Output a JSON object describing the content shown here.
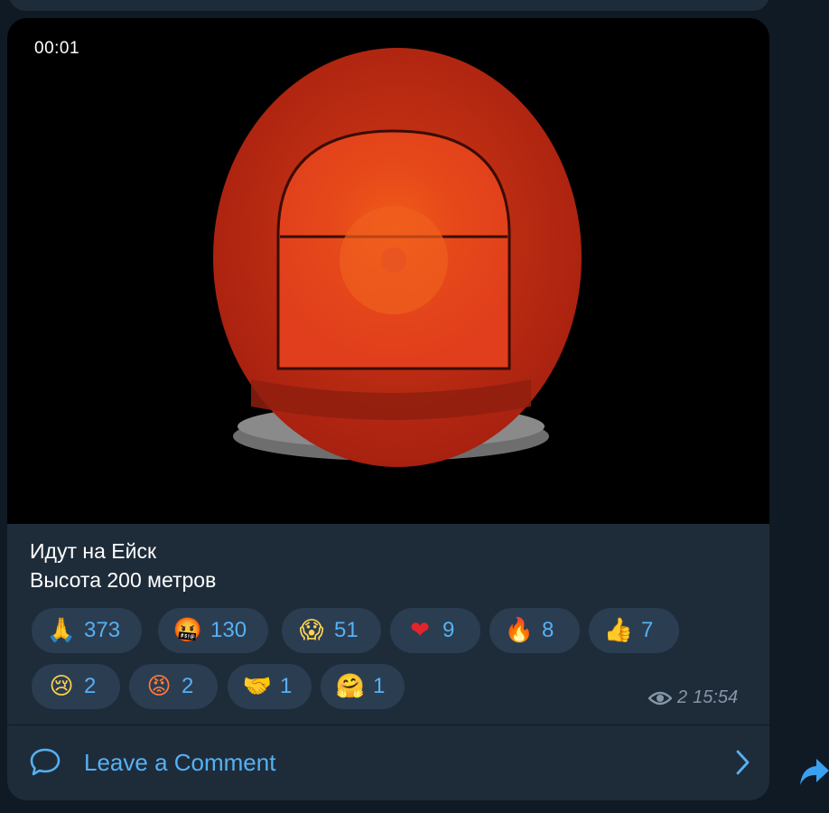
{
  "media": {
    "duration": "00:01"
  },
  "caption": {
    "line1": "Идут на Ейск",
    "line2": "Высота 200 метров"
  },
  "reactions": [
    {
      "icon": "praying-hands-emoji",
      "glyph": "🙏",
      "count": "373"
    },
    {
      "icon": "cursing-face-emoji",
      "glyph": "🤬",
      "count": "130"
    },
    {
      "icon": "screaming-face-emoji",
      "glyph": "😱",
      "count": "51"
    },
    {
      "icon": "red-heart-emoji",
      "glyph": "❤",
      "count": "9"
    },
    {
      "icon": "fire-emoji",
      "glyph": "🔥",
      "count": "8"
    },
    {
      "icon": "thumbs-up-emoji",
      "glyph": "👍",
      "count": "7"
    },
    {
      "icon": "crying-face-emoji",
      "glyph": "😢",
      "count": "2"
    },
    {
      "icon": "angry-face-emoji",
      "glyph": "😡",
      "count": "2"
    },
    {
      "icon": "handshake-emoji",
      "glyph": "🤝",
      "count": "1"
    },
    {
      "icon": "hugging-face-emoji",
      "glyph": "🤗",
      "count": "1"
    }
  ],
  "meta": {
    "views": "2",
    "time": "15:54"
  },
  "comments": {
    "label": "Leave a Comment"
  },
  "colors": {
    "background": "#101a24",
    "bubble": "#1e2c3a",
    "pill": "#2b3d51",
    "accent": "#55b1f4",
    "muted": "#8696a6",
    "siren_red": "#b52a10"
  }
}
